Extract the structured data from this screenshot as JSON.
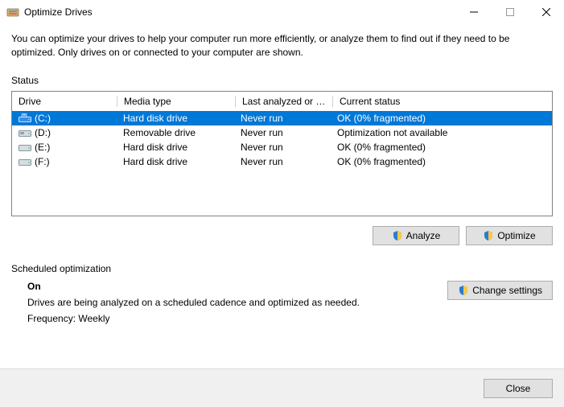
{
  "window": {
    "title": "Optimize Drives"
  },
  "intro": "You can optimize your drives to help your computer run more efficiently, or analyze them to find out if they need to be optimized. Only drives on or connected to your computer are shown.",
  "status_label": "Status",
  "columns": {
    "drive": "Drive",
    "media": "Media type",
    "last": "Last analyzed or o...",
    "current": "Current status"
  },
  "drives": [
    {
      "name": "(C:)",
      "media": "Hard disk drive",
      "last": "Never run",
      "status": "OK (0% fragmented)",
      "icon": "os-drive",
      "selected": true
    },
    {
      "name": "(D:)",
      "media": "Removable drive",
      "last": "Never run",
      "status": "Optimization not available",
      "icon": "removable-drive",
      "selected": false
    },
    {
      "name": "(E:)",
      "media": "Hard disk drive",
      "last": "Never run",
      "status": "OK (0% fragmented)",
      "icon": "hdd-drive",
      "selected": false
    },
    {
      "name": "(F:)",
      "media": "Hard disk drive",
      "last": "Never run",
      "status": "OK (0% fragmented)",
      "icon": "hdd-drive",
      "selected": false
    }
  ],
  "buttons": {
    "analyze": "Analyze",
    "optimize": "Optimize",
    "change_settings": "Change settings",
    "close": "Close"
  },
  "scheduled": {
    "label": "Scheduled optimization",
    "state": "On",
    "desc": "Drives are being analyzed on a scheduled cadence and optimized as needed.",
    "freq": "Frequency: Weekly"
  }
}
